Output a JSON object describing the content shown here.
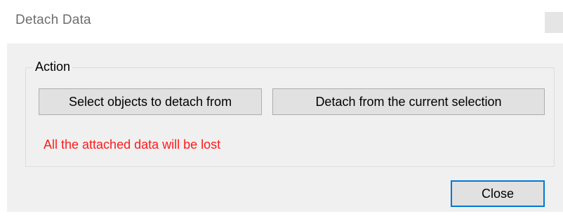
{
  "window": {
    "title": "Detach Data"
  },
  "group": {
    "label": "Action"
  },
  "buttons": {
    "select_objects": "Select objects to detach from",
    "detach_current": "Detach from the current selection",
    "close": "Close"
  },
  "warning": {
    "text": "All the attached data will be lost",
    "color": "#ff1a1a"
  },
  "colors": {
    "focus_border": "#0078d7",
    "dialog_background": "#f0f0f0",
    "button_face": "#e1e1e1"
  }
}
